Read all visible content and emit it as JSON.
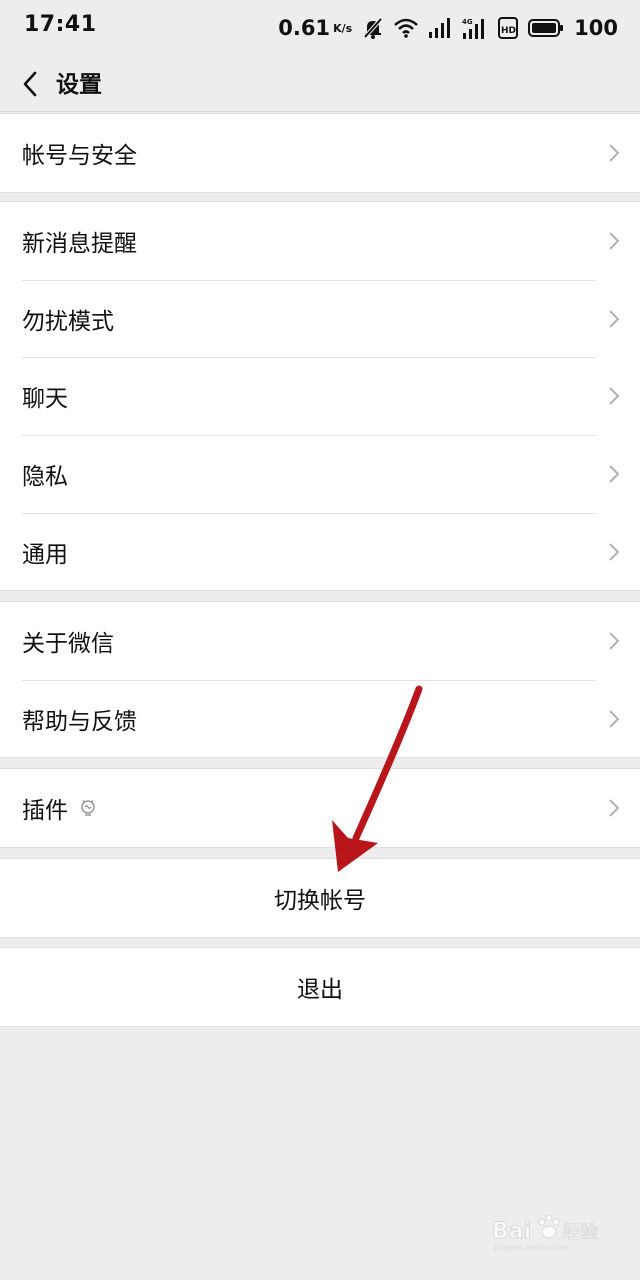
{
  "status_bar": {
    "time": "17:41",
    "net_speed": "0.61",
    "net_unit": "K/s",
    "battery": "100",
    "icons": [
      "mute-bell-icon",
      "wifi-icon",
      "signal-icon",
      "signal-4g-icon",
      "hd-icon",
      "battery-icon"
    ]
  },
  "nav": {
    "back_icon": "chevron-left-icon",
    "title": "设置"
  },
  "groups": {
    "account": {
      "items": [
        {
          "label": "帐号与安全"
        }
      ]
    },
    "general": {
      "items": [
        {
          "label": "新消息提醒"
        },
        {
          "label": "勿扰模式"
        },
        {
          "label": "聊天"
        },
        {
          "label": "隐私"
        },
        {
          "label": "通用"
        }
      ]
    },
    "about": {
      "items": [
        {
          "label": "关于微信"
        },
        {
          "label": "帮助与反馈"
        }
      ]
    },
    "plugins": {
      "items": [
        {
          "label": "插件",
          "icon": "plugin-bulb-icon"
        }
      ]
    }
  },
  "actions": {
    "switch_account": "切换帐号",
    "logout": "退出"
  },
  "annotation": {
    "arrow_color": "#b8161b"
  },
  "colors": {
    "background": "#ededed",
    "cell": "#ffffff",
    "text": "#111111",
    "chevron": "#b2b2b2"
  }
}
